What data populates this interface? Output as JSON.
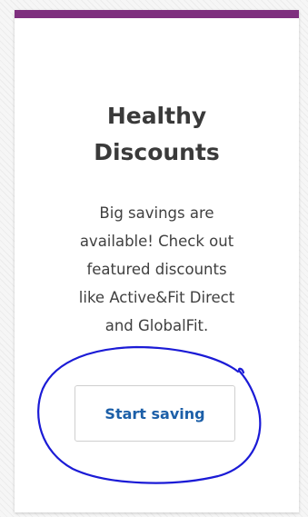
{
  "card": {
    "title": "Healthy\nDiscounts",
    "description": "Big savings are\navailable! Check out\nfeatured discounts\nlike Active&Fit Direct\nand GlobalFit.",
    "cta_label": "Start saving"
  },
  "colors": {
    "accent_bar": "#7e2f7e",
    "cta_text": "#1c5fa8",
    "annotation_ink": "#1b1bd6"
  }
}
